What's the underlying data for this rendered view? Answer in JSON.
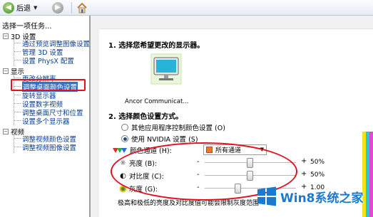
{
  "toolbar": {
    "back_label": "后退",
    "back_icon": "back-arrow-icon",
    "forward_icon": "forward-arrow-icon",
    "home_icon": "home-icon"
  },
  "sidebar": {
    "title": "选择一项任务...",
    "categories": [
      {
        "label": "3D 设置",
        "items": [
          "通过预览调整图像设置",
          "管理 3D 设置",
          "设置 PhysX 配置"
        ]
      },
      {
        "label": "显示",
        "items": [
          "更改分辨率",
          "调整桌面颜色设置",
          "旋转显示器",
          "设置数字视频",
          "调整桌面尺寸和位置",
          "设置多个显示器"
        ]
      },
      {
        "label": "视频",
        "items": [
          "调整视频颜色设置",
          "调整视频图像设置"
        ]
      }
    ],
    "selected_item": "调整桌面颜色设置"
  },
  "main": {
    "section1": "1. 选择您希望更改的显示器。",
    "monitor_label": "Ancor Communicat...",
    "section2": "2. 选择颜色设置方式。",
    "radio_other": "其他应用程序控制颜色设置 (O)",
    "radio_nvidia": "使用 NVIDIA 设置 (S)",
    "channel_label": "颜色通道 (H):",
    "channel_value": "所有通道",
    "brightness_label": "亮度 (B):",
    "brightness_value": "50%",
    "brightness_level": 0.5,
    "contrast_label": "对比度 (C):",
    "contrast_value": "50%",
    "contrast_level": 0.5,
    "gamma_label": "灰度 (G):",
    "gamma_value": "1.00",
    "gamma_level": 0.36,
    "note": "极高和极低的亮度及对比度值可能会限制灰度范围"
  },
  "watermark": {
    "text": "Win8系统之家"
  },
  "colors": {
    "highlight_red": "#e3101e",
    "selection_blue": "#3470c8",
    "link_blue": "#0a3d8f"
  }
}
